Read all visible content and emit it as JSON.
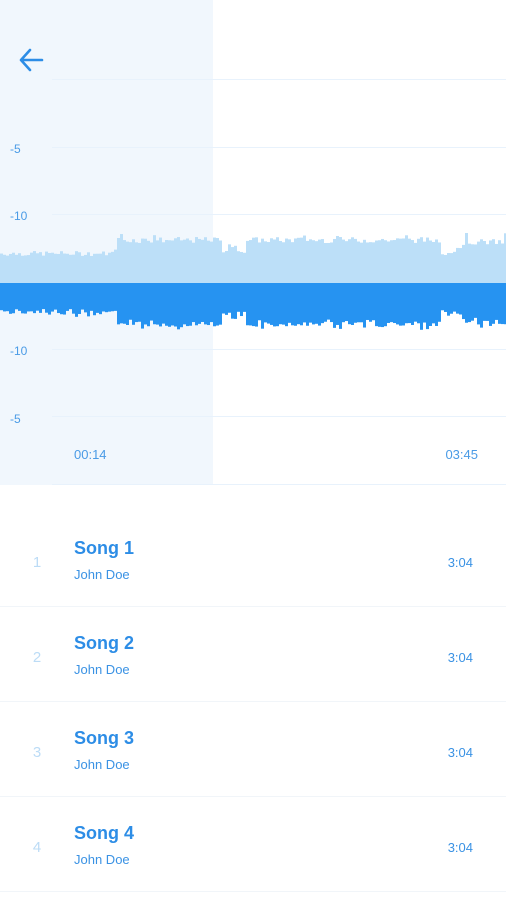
{
  "header": {
    "back_icon": "arrow-left-icon"
  },
  "waveform": {
    "y_labels_top": [
      "-5",
      "-10"
    ],
    "y_labels_bottom": [
      "-10",
      "-5"
    ],
    "time_elapsed": "00:14",
    "time_total": "03:45",
    "progress": 0.062,
    "colors": {
      "played": "#2693f1",
      "unplayed": "#bcdff8",
      "accent": "#2d8de6"
    }
  },
  "playlist": {
    "tracks": [
      {
        "number": "1",
        "title": "Song 1",
        "artist": "John Doe",
        "duration": "3:04"
      },
      {
        "number": "2",
        "title": "Song 2",
        "artist": "John Doe",
        "duration": "3:04"
      },
      {
        "number": "3",
        "title": "Song 3",
        "artist": "John Doe",
        "duration": "3:04"
      },
      {
        "number": "4",
        "title": "Song 4",
        "artist": "John Doe",
        "duration": "3:04"
      }
    ]
  }
}
